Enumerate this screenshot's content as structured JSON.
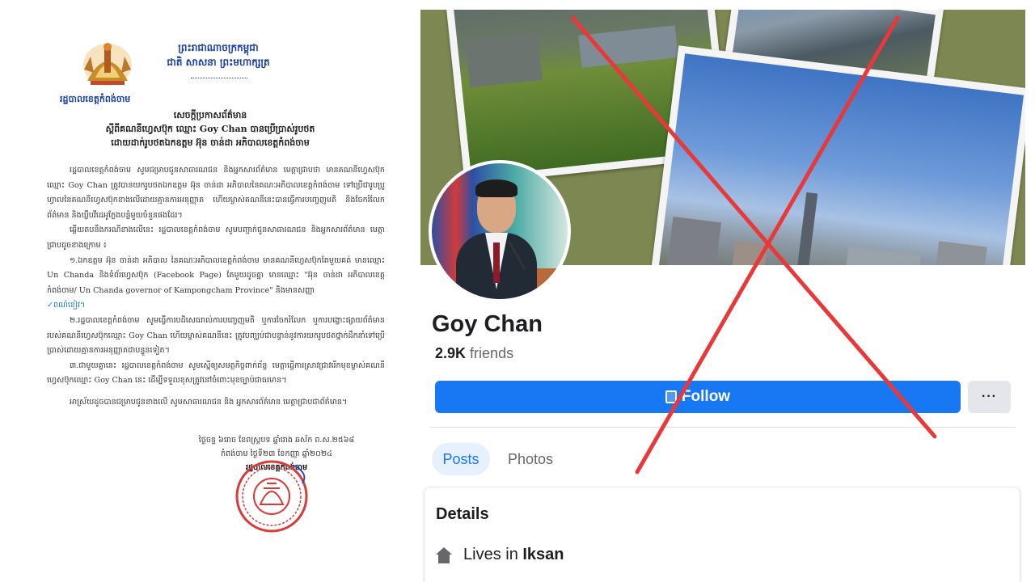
{
  "document": {
    "kingdom_line1": "ព្រះរាជាណាចក្រកម្ពុជា",
    "kingdom_line2": "ជាតិ សាសនា ព្រះមហាក្សត្រ",
    "issuer": "រដ្ឋបាលខេត្តកំពង់ចាម",
    "title_line1": "សេចក្តីប្រកាសព័ត៌មាន",
    "title_line2": "ស្តីពីគណនីហ្វេសប៊ុក ឈ្មោះ Goy Chan បានប្រើប្រាស់រូបថត",
    "title_line3": "ដោយដាក់រូបថតឯកឧត្តម អ៊ុន ចាន់ដា អភិបាលខេត្តកំពង់ចាម",
    "para1": "រដ្ឋបាលខេត្តកំពង់ចាម សូមជម្រាបជូនសាធារណជន និងអ្នកសារព័ត៌មាន មេត្តាជ្រាបថា មានគណនីហ្វេសប៊ុកឈ្មោះ Goy Chan ត្រូវបានយករូបថតឯកឧត្តម អ៊ុន ចាន់ដា អភិបាលនៃគណៈអភិបាលខេត្តកំពង់ចាម ទៅប្រើជារូបប្រូហ្វាលនៃគណនីហ្វេសប៊ុកខាងលើដោយគ្មានការអនុញ្ញាត ហើយម្ចាស់គណនីនេះបានធ្វើការបញ្ចេញមតិ និងចែករំលែកព័ត៌មាន និងឃ្លីបវីដេអូក្លែងបន្លំមួយចំនួនផងដែរ។",
    "para2": "ឆ្លើយតបនឹងករណីខាងលើនេះ រដ្ឋបាលខេត្តកំពង់ចាម សូមបញ្ជាក់ជូនសាធារណជន និងអ្នកសារព័ត៌មាន មេត្តាជ្រាបដូចខាងក្រោម ៖",
    "para3": "១.ឯកឧត្តម អ៊ុន ចាន់ដា អភិបាល នៃគណៈអភិបាលខេត្តកំពង់ចាម មានគណនីហ្វេសប៊ុកតែមួយគត់ មានឈ្មោះ Un Chanda និងទំព័រហ្វេសប៊ុក (Facebook Page) តែមួយដូចគ្នា មានឈ្មោះ \"អ៊ុន ចាន់ដា អភិបាលខេត្តកំពង់ចាម/ Un Chanda governor of Kampongcham Province\" និងមានសញ្ញា",
    "para3_check": "✓ពណ៌ខៀវ។",
    "para4": "២.រដ្ឋបាលខេត្តកំពង់ចាម សូមធ្វើការបដិសេធរាល់ការបញ្ចេញមតិ ឬការចែករំលែក ឬការបង្ហោះផ្សាយព័ត៌មានរបស់គណនីហ្វេសប៊ុកឈ្មោះ Goy Chan ហើយម្ចាស់គណនីនេះ ត្រូវបញ្ឈប់ជាបន្ទាន់នូវការយករូបថតថ្នាក់ដឹកនាំទៅប្រើប្រាស់ដោយគ្មានការអនុញ្ញាតជាបន្ទូនទៀត។",
    "para5": "៣.ជាមួយគ្នានេះ រដ្ឋបាលខេត្តកំពង់ចាម សូមស្នើឲ្យសមត្ថកិច្ចពាក់ព័ន្ធ មេត្តាធ្វើការស្រាវជ្រាវរើកមុខម្ចាស់គណនីហ្វេសប៊ុកឈ្មោះ Goy Chan នេះ ដើម្បីទទួលខុសត្រូវនៅចំពោះមុខច្បាប់ជាធរមាន។",
    "closing": "អាស្រ័យដូចបានជម្រាបជូនខាងលើ សូមសាធារណជន និង អ្នកសារព័ត៌មាន មេត្តាជ្រាបជាព័ត៌មាន។",
    "date_lunar": "ថ្ងៃចន្ទ ៦រោច ខែពស្រ្តបទ ឆ្នាំរោង ឆស័ក ព.ស.២៥៦៨",
    "date_solar": "កំពង់ចាម ថ្ងៃទី២៣ ខែកញ្ញា ឆ្នាំ២០២៤",
    "signatory": "រដ្ឋបាលខេត្តកំពង់ចាម",
    "seal_color": "#d93a3a"
  },
  "profile": {
    "name": "Goy Chan",
    "friends_count": "2.9K",
    "friends_label": "friends",
    "follow_label": "Follow",
    "more_label": "···",
    "tabs": [
      "Posts",
      "Photos"
    ],
    "details_title": "Details",
    "lives_prefix": "Lives in",
    "lives_place": "Iksan",
    "accent": "#1877f2",
    "cross_color": "#e8393a"
  }
}
